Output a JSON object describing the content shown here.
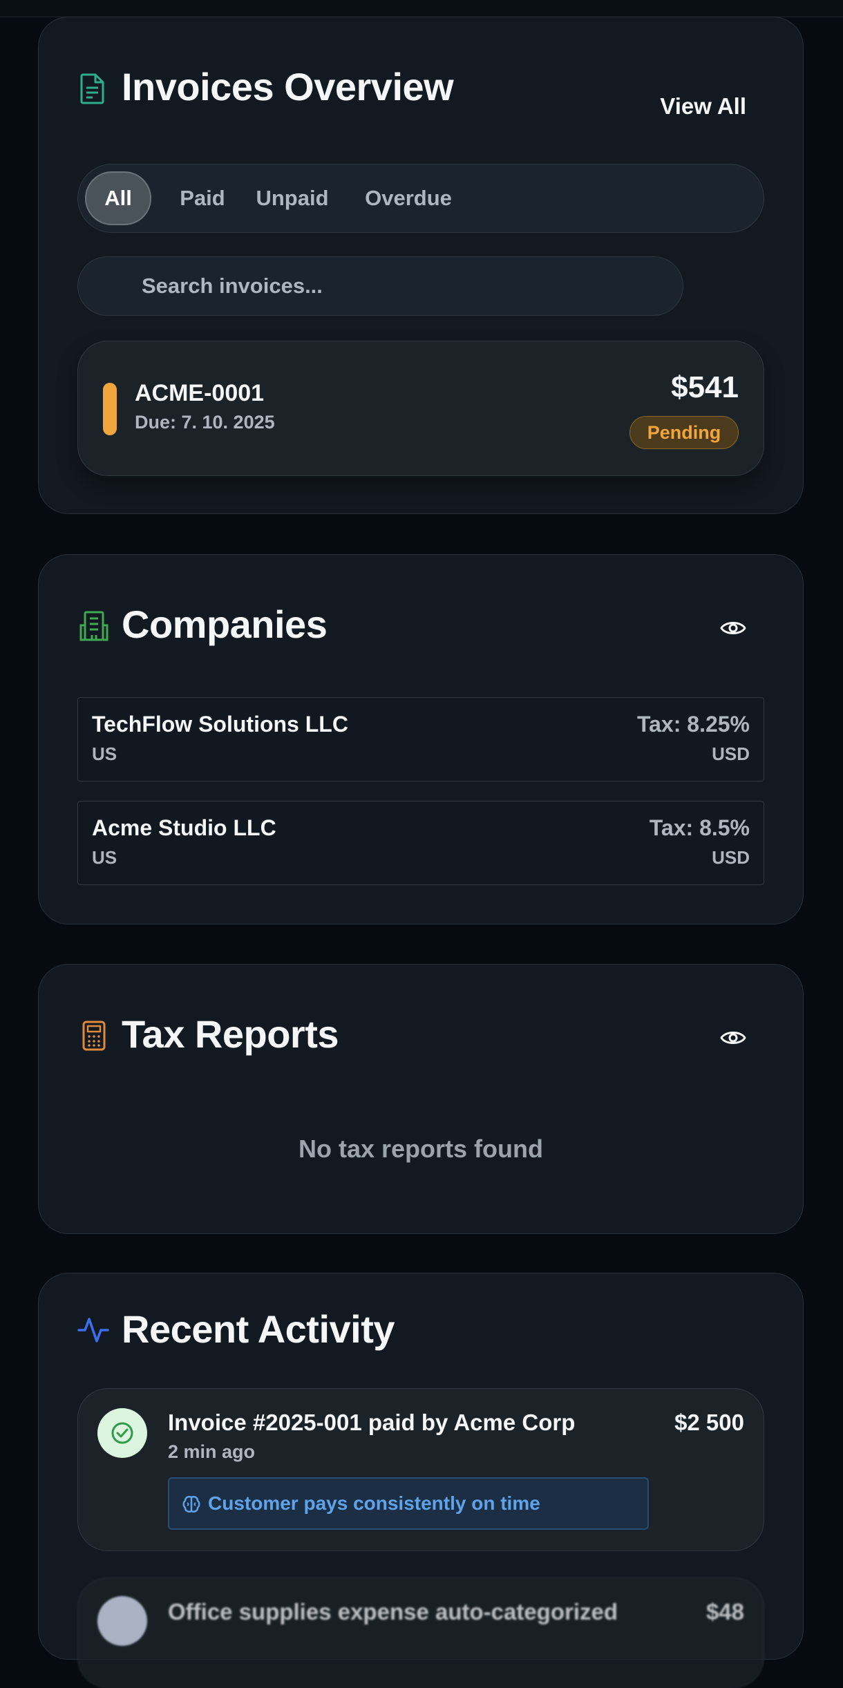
{
  "colors": {
    "background": "#050b10",
    "card": "#121920",
    "pending": "#f0a63c",
    "invoice_icon": "#2fae8c",
    "company_icon": "#3faa52",
    "tax_icon": "#e08a3a",
    "activity_icon": "#3b6ff0",
    "insight": "#5fa3ea"
  },
  "invoices": {
    "title": "Invoices Overview",
    "icon": "document-icon",
    "view_all": "View All",
    "filters": [
      "All",
      "Paid",
      "Unpaid",
      "Overdue"
    ],
    "active_filter": "All",
    "search_placeholder": "Search invoices...",
    "items": [
      {
        "id": "ACME-0001",
        "due": "Due: 7. 10. 2025",
        "amount": "$541",
        "status": "Pending"
      }
    ]
  },
  "companies": {
    "title": "Companies",
    "icon": "building-icon",
    "items": [
      {
        "name": "TechFlow Solutions LLC",
        "country": "US",
        "tax": "Tax: 8.25%",
        "currency": "USD"
      },
      {
        "name": "Acme Studio LLC",
        "country": "US",
        "tax": "Tax: 8.5%",
        "currency": "USD"
      }
    ]
  },
  "tax_reports": {
    "title": "Tax Reports",
    "icon": "calculator-icon",
    "empty_message": "No tax reports found"
  },
  "activity": {
    "title": "Recent Activity",
    "icon": "pulse-icon",
    "items": [
      {
        "title": "Invoice #2025-001 paid by Acme Corp",
        "time": "2 min ago",
        "amount": "$2 500",
        "insight": "Customer pays consistently on time",
        "icon": "check-circle-icon"
      },
      {
        "title": "Office supplies expense auto-categorized",
        "amount": "$48"
      }
    ]
  }
}
